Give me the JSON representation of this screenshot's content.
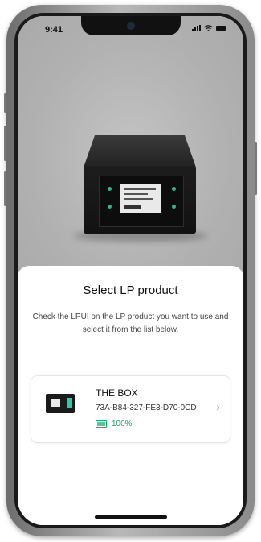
{
  "status_bar": {
    "time": "9:41",
    "signal_icon": "signal-icon",
    "wifi_icon": "wifi-icon",
    "battery_icon": "battery-icon"
  },
  "hero": {
    "image": "lp-box-product-photo"
  },
  "sheet": {
    "title": "Select LP product",
    "description": "Check the LPUI on the LP product you want to use and select it from the list below."
  },
  "products": [
    {
      "name": "THE BOX",
      "id": "73A-B84-327-FE3-D70-0CD",
      "battery": "100%",
      "battery_color": "#1aa86b",
      "thumbnail_icon": "product-box-icon",
      "chevron_icon": "chevron-right-icon"
    }
  ],
  "colors": {
    "accent": "#2fc7b0",
    "battery_green": "#1aa86b",
    "hero_bg": "#b4b4b4"
  }
}
